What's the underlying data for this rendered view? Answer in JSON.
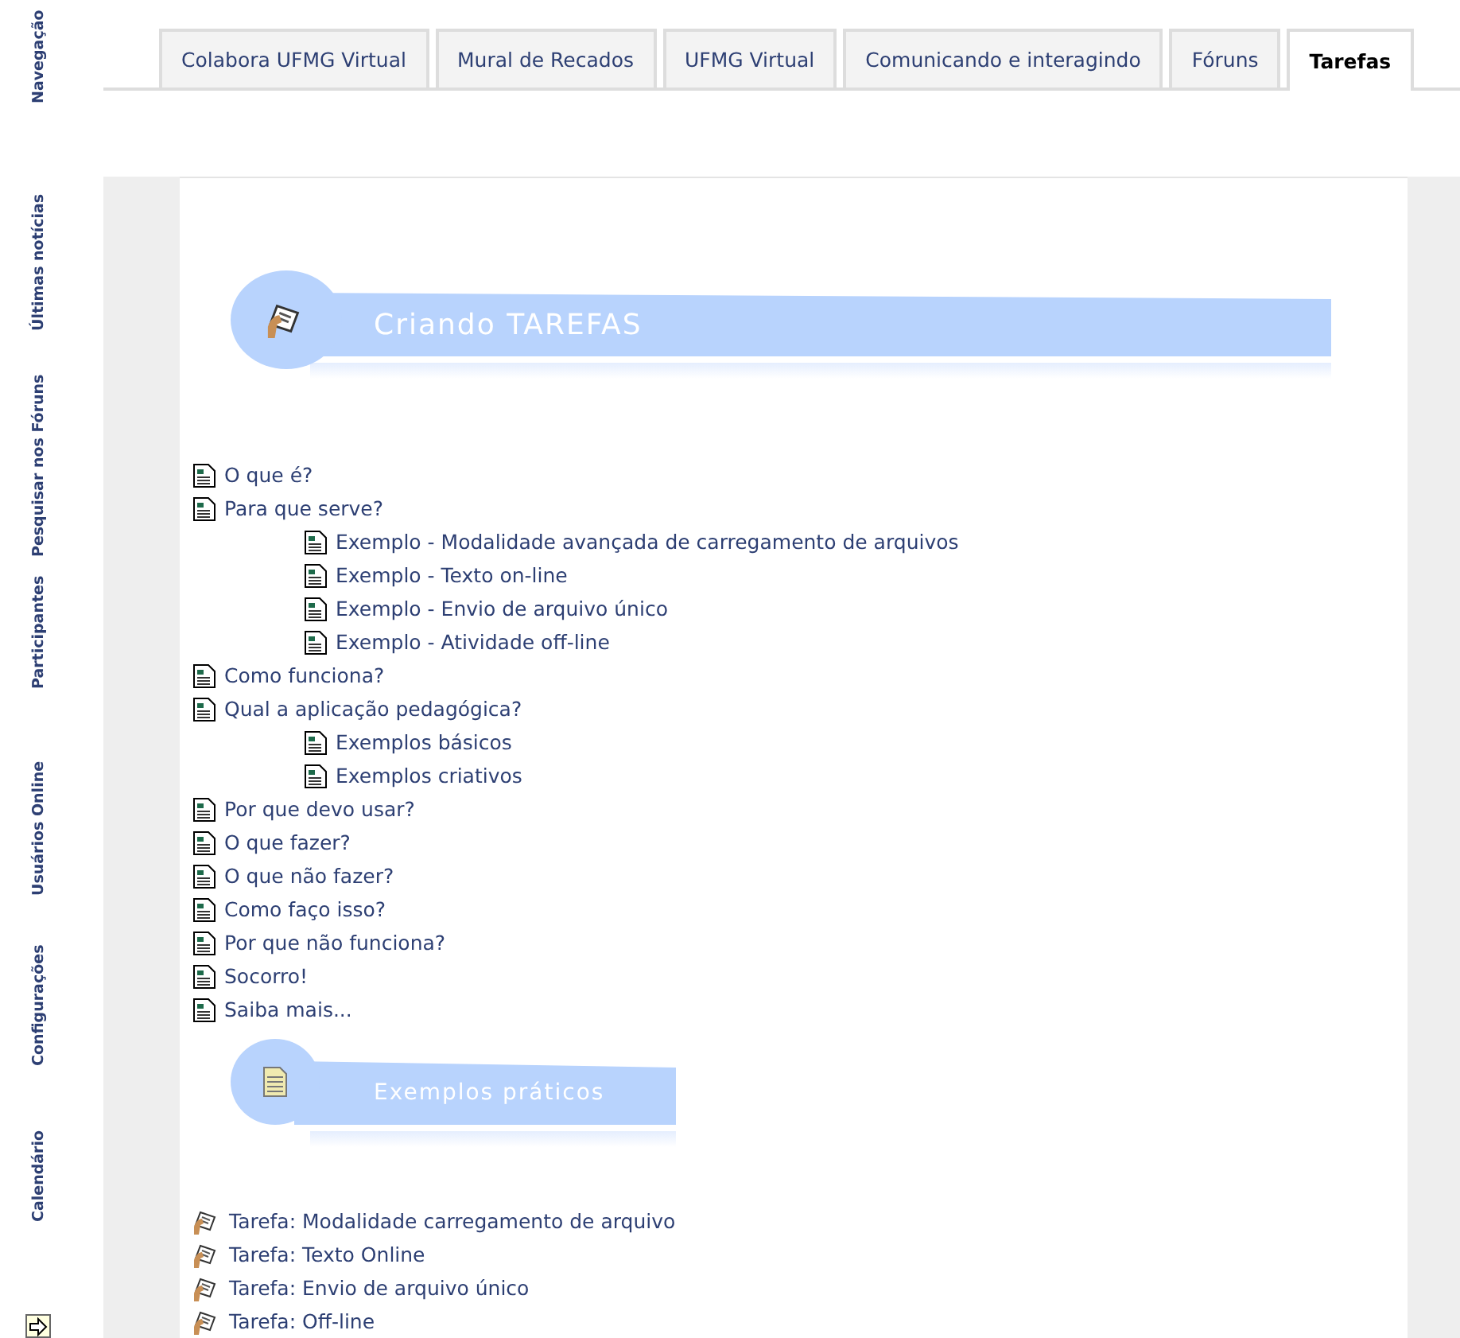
{
  "sidebar": {
    "blocks": [
      {
        "label": "Navegação"
      },
      {
        "label": "Últimas notícias"
      },
      {
        "label": "Pesquisar nos Fóruns"
      },
      {
        "label": "Participantes"
      },
      {
        "label": "Usuários Online"
      },
      {
        "label": "Configurações"
      },
      {
        "label": "Calendário"
      }
    ]
  },
  "tabs": [
    {
      "label": "Colabora UFMG Virtual",
      "selected": false
    },
    {
      "label": "Mural de Recados",
      "selected": false
    },
    {
      "label": "UFMG Virtual",
      "selected": false
    },
    {
      "label": "Comunicando e interagindo",
      "selected": false
    },
    {
      "label": "Fóruns",
      "selected": false
    },
    {
      "label": "Tarefas",
      "selected": true
    }
  ],
  "banner": {
    "title": "Criando TAREFAS"
  },
  "topics": [
    {
      "label": "O que é?"
    },
    {
      "label": "Para que serve?",
      "children": [
        {
          "label": "Exemplo - Modalidade avançada de carregamento de arquivos"
        },
        {
          "label": "Exemplo - Texto on-line"
        },
        {
          "label": "Exemplo - Envio de arquivo único"
        },
        {
          "label": "Exemplo - Atividade off-line"
        }
      ]
    },
    {
      "label": "Como funciona?"
    },
    {
      "label": "Qual a aplicação pedagógica?",
      "children": [
        {
          "label": "Exemplos básicos"
        },
        {
          "label": "Exemplos criativos"
        }
      ]
    },
    {
      "label": "Por que devo usar?"
    },
    {
      "label": "O que fazer?"
    },
    {
      "label": "O que não fazer?"
    },
    {
      "label": "Como faço isso?"
    },
    {
      "label": "Por que não funciona?"
    },
    {
      "label": "Socorro!"
    },
    {
      "label": "Saiba mais..."
    }
  ],
  "examples_banner": {
    "title": "Exemplos práticos"
  },
  "tasks": [
    {
      "label": "Tarefa: Modalidade carregamento de arquivo"
    },
    {
      "label": "Tarefa: Texto Online"
    },
    {
      "label": "Tarefa: Envio de arquivo único"
    },
    {
      "label": "Tarefa: Off-line"
    }
  ]
}
